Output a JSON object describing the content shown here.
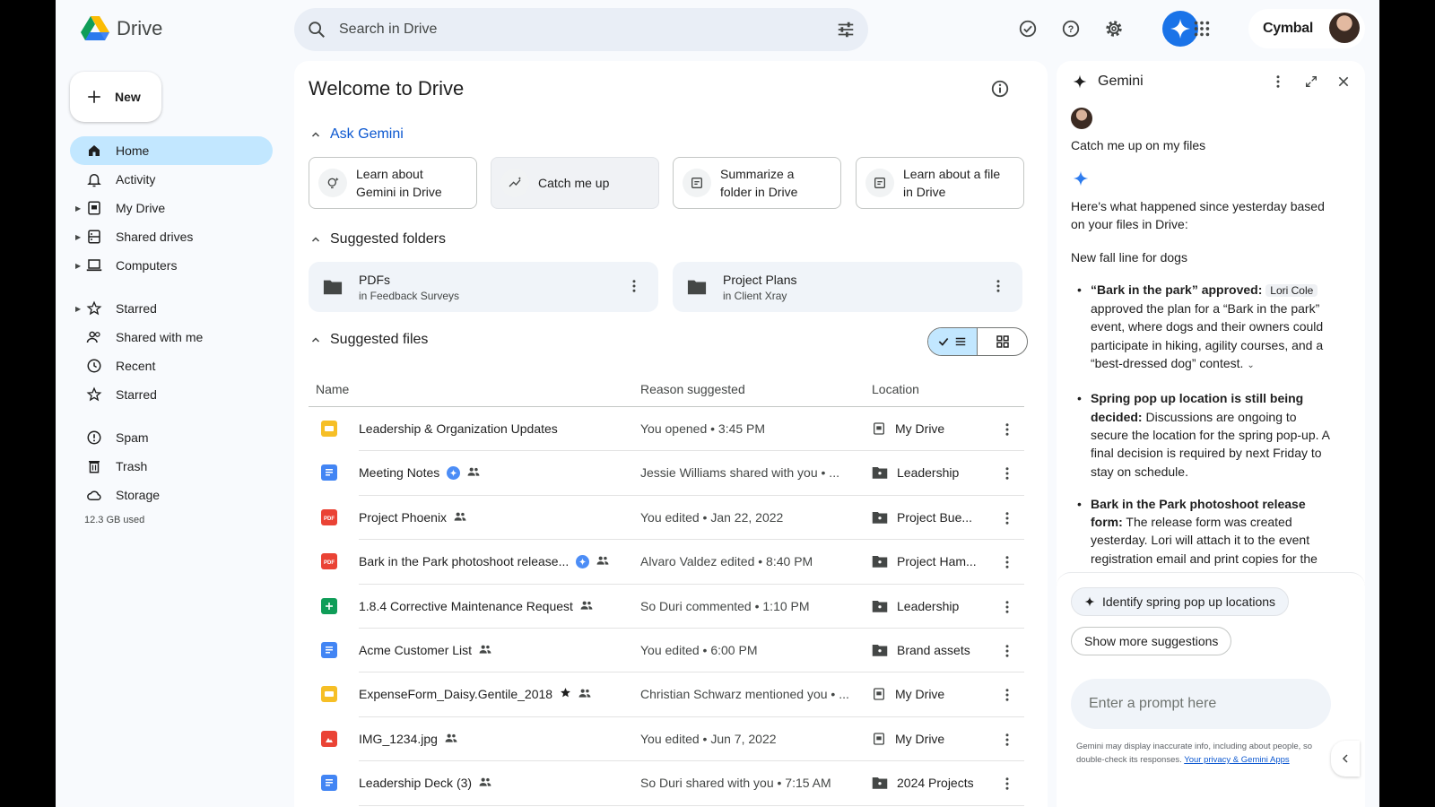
{
  "header": {
    "app_title": "Drive",
    "search_placeholder": "Search in Drive",
    "brand": "Cymbal",
    "icons": [
      "ready-for-offline-icon",
      "help-icon",
      "settings-icon",
      "gemini-icon",
      "apps-grid-icon"
    ]
  },
  "sidebar": {
    "new_label": "New",
    "items": [
      {
        "label": "Home",
        "icon": "home-icon"
      },
      {
        "label": "Activity",
        "icon": "bell-icon"
      },
      {
        "label": "My Drive",
        "icon": "my-drive-icon"
      },
      {
        "label": "Shared drives",
        "icon": "shared-drives-icon"
      },
      {
        "label": "Computers",
        "icon": "computer-icon"
      },
      {
        "label": "Starred",
        "icon": "star-icon"
      },
      {
        "label": "Shared with me",
        "icon": "people-icon"
      },
      {
        "label": "Recent",
        "icon": "clock-icon"
      },
      {
        "label": "Starred",
        "icon": "star-icon"
      },
      {
        "label": "Spam",
        "icon": "spam-icon"
      },
      {
        "label": "Trash",
        "icon": "trash-icon"
      },
      {
        "label": "Storage",
        "icon": "cloud-icon"
      }
    ],
    "storage_used": "12.3 GB used"
  },
  "main": {
    "title": "Welcome to Drive",
    "ask_gemini": "Ask Gemini",
    "chips": [
      {
        "line1": "Learn about",
        "line2": "Gemini in Drive"
      },
      {
        "line1": "Catch me up",
        "line2": ""
      },
      {
        "line1": "Summarize a",
        "line2": "folder in Drive"
      },
      {
        "line1": "Learn about a file",
        "line2": "in Drive"
      }
    ],
    "suggested_folders_label": "Suggested folders",
    "folders": [
      {
        "name": "PDFs",
        "location": "in Feedback Surveys"
      },
      {
        "name": "Project Plans",
        "location": "in Client Xray"
      }
    ],
    "suggested_files_label": "Suggested files",
    "columns": {
      "name": "Name",
      "reason": "Reason suggested",
      "location": "Location"
    },
    "files": [
      {
        "name": "Leadership & Organization Updates",
        "reason": "You opened • 3:45 PM",
        "location": "My Drive",
        "type": "slides"
      },
      {
        "name": "Meeting Notes",
        "reason": "Jessie Williams shared with you • ...",
        "location": "Leadership",
        "type": "docs"
      },
      {
        "name": "Project Phoenix",
        "reason": "You edited • Jan 22, 2022",
        "location": "Project Bue...",
        "type": "pdf"
      },
      {
        "name": "Bark in the Park photoshoot release...",
        "reason": "Alvaro Valdez edited • 8:40 PM",
        "location": "Project Ham...",
        "type": "pdf"
      },
      {
        "name": "1.8.4 Corrective Maintenance Request",
        "reason": "So Duri commented • 1:10 PM",
        "location": "Leadership",
        "type": "sheets"
      },
      {
        "name": "Acme Customer List",
        "reason": "You edited • 6:00 PM",
        "location": "Brand assets",
        "type": "docs"
      },
      {
        "name": "ExpenseForm_Daisy.Gentile_2018",
        "reason": "Christian Schwarz mentioned you • ...",
        "location": "My Drive",
        "type": "slides"
      },
      {
        "name": "IMG_1234.jpg",
        "reason": "You edited • Jun 7, 2022",
        "location": "My Drive",
        "type": "image"
      },
      {
        "name": "Leadership Deck (3)",
        "reason": "So Duri shared with you • 7:15 AM",
        "location": "2024 Projects",
        "type": "docs"
      }
    ]
  },
  "gemini": {
    "title": "Gemini",
    "question": "Catch me up on my files",
    "intro": "Here's what happened since yesterday based on your files in Drive:",
    "section": "New fall line for dogs",
    "bullet1_bold": "“Bark in the park” approved:",
    "bullet1_person": "Lori Cole",
    "bullet1_text": "approved the plan for a “Bark in the park” event, where dogs and their owners could participate in hiking, agility courses, and a “best-dressed dog” contest.",
    "bullet2_bold": "Spring pop up location is still being decided:",
    "bullet2_text": "Discussions are ongoing to secure the location for the spring pop-up. A final decision is required by next Friday to stay on schedule.",
    "bullet3_bold": "Bark in the Park photoshoot release form:",
    "bullet3_text": "The release form was created yesterday. Lori will attach it to the event registration email and print copies for the day of the event. You need to review the",
    "suggestion1": "Identify spring pop up locations",
    "suggestion2": "Show more suggestions",
    "prompt_placeholder": "Enter a prompt here",
    "disclaimer": "Gemini may display inaccurate info, including about people, so double-check its responses.",
    "privacy_link": "Your privacy & Gemini Apps"
  },
  "colors": {
    "accent": "#0b57d0",
    "active_nav": "#c2e7ff",
    "gemini_button": "#1a73e8",
    "slides": "#f6bf26",
    "docs": "#4285f4",
    "pdf": "#ea4335",
    "sheets": "#0f9d58",
    "image": "#ea4335"
  }
}
